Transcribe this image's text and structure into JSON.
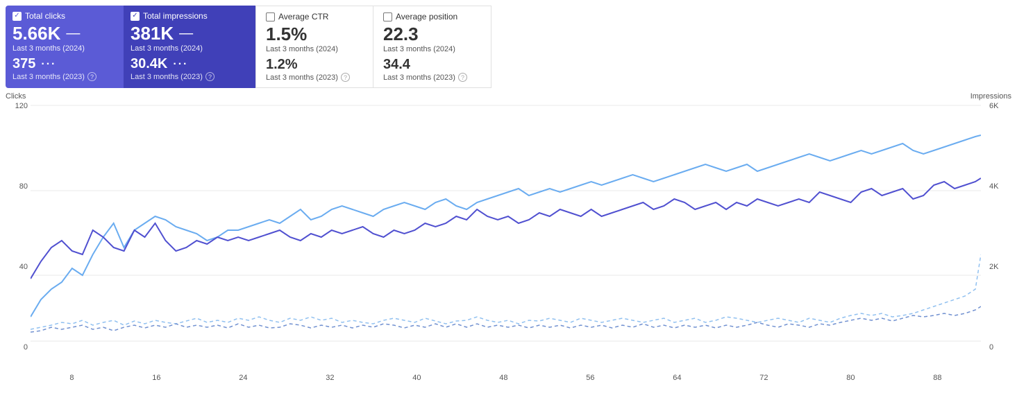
{
  "metrics": [
    {
      "id": "total-clicks",
      "label": "Total clicks",
      "style": "active-blue",
      "checked": true,
      "value": "5.66K",
      "dash": "—",
      "sub1": "Last 3 months (2024)",
      "value2": "375",
      "dots": "···",
      "sub2": "Last 3 months (2023)",
      "hasQuestion": true
    },
    {
      "id": "total-impressions",
      "label": "Total impressions",
      "style": "active-purple",
      "checked": true,
      "value": "381K",
      "dash": "—",
      "sub1": "Last 3 months (2024)",
      "value2": "30.4K",
      "dots": "···",
      "sub2": "Last 3 months (2023)",
      "hasQuestion": true
    },
    {
      "id": "average-ctr",
      "label": "Average CTR",
      "style": "inactive",
      "checked": false,
      "value": "1.5%",
      "dash": "",
      "sub1": "Last 3 months (2024)",
      "value2": "1.2%",
      "dots": "",
      "sub2": "Last 3 months (2023)",
      "hasQuestion": true
    },
    {
      "id": "average-position",
      "label": "Average position",
      "style": "inactive",
      "checked": false,
      "value": "22.3",
      "dash": "",
      "sub1": "Last 3 months (2024)",
      "value2": "34.4",
      "dots": "",
      "sub2": "Last 3 months (2023)",
      "hasQuestion": true
    }
  ],
  "chart": {
    "yAxisLeft": {
      "label": "Clicks",
      "values": [
        "120",
        "80",
        "40",
        "0"
      ]
    },
    "yAxisRight": {
      "label": "Impressions",
      "values": [
        "6K",
        "4K",
        "2K",
        "0"
      ]
    },
    "xAxis": [
      "8",
      "16",
      "24",
      "32",
      "40",
      "48",
      "56",
      "64",
      "72",
      "80",
      "88"
    ]
  }
}
